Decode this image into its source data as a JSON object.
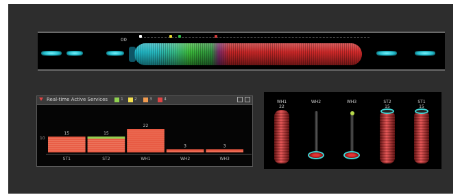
{
  "timeline": {
    "label": "00",
    "marker_colors": [
      "#ffffff",
      "#e6d630",
      "#2fbf4a",
      "#d23b3b"
    ]
  },
  "services_panel": {
    "title": "Real-time Active Services",
    "legend": [
      {
        "value": "1",
        "color": "#8fd14f"
      },
      {
        "value": "2",
        "color": "#f4e04d"
      },
      {
        "value": "3",
        "color": "#f29b4f"
      },
      {
        "value": "4",
        "color": "#e04444"
      }
    ],
    "y_tick": "10",
    "window_buttons": [
      "restore",
      "close"
    ]
  },
  "chart_data": {
    "type": "bar",
    "categories": [
      "ST1",
      "ST2",
      "WH1",
      "WH2",
      "WH3"
    ],
    "values": [
      15,
      15,
      22,
      3,
      3
    ],
    "data_labels": [
      "15",
      "15",
      "22",
      "3",
      "3"
    ],
    "colors": {
      "bar": "#e85a43",
      "stripe": "#f08c73",
      "highlight": "#8fd14f"
    }
  },
  "towers_panel": {
    "towers": [
      {
        "label": "WH1",
        "sub": "22",
        "kind": "full"
      },
      {
        "label": "WH2",
        "sub": "",
        "kind": "rod"
      },
      {
        "label": "WH3",
        "sub": "",
        "kind": "rod-bulb"
      },
      {
        "label": "ST2",
        "sub": "15",
        "kind": "full"
      },
      {
        "label": "ST1",
        "sub": "15",
        "kind": "full"
      }
    ]
  }
}
